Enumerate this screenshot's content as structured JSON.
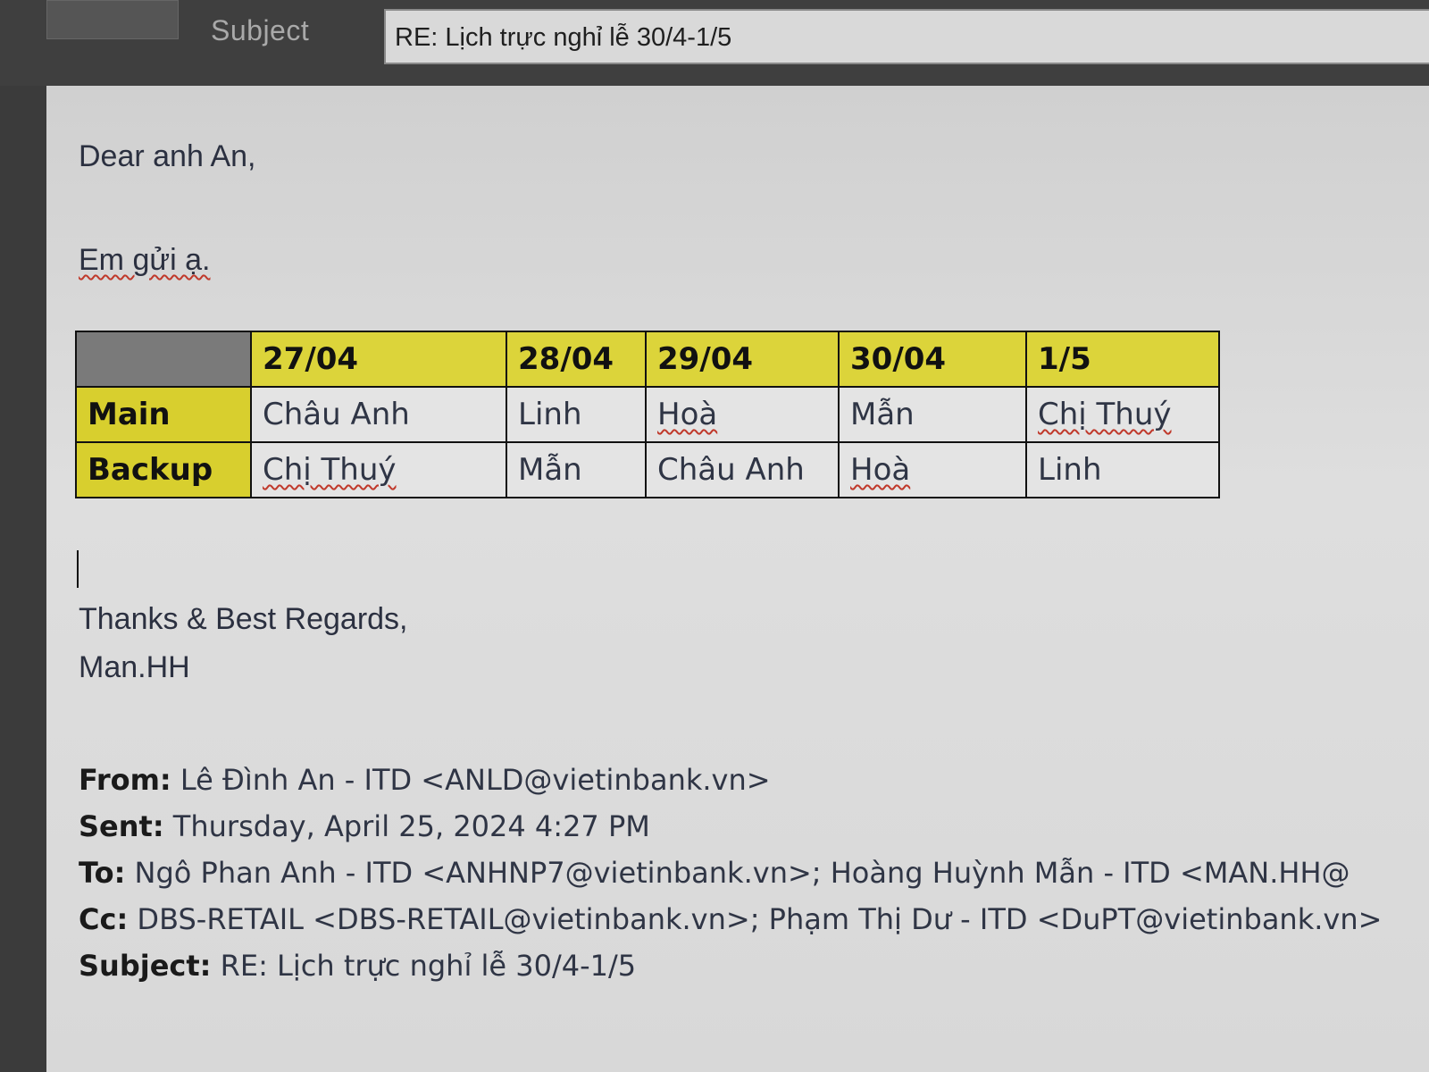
{
  "header": {
    "subject_label": "Subject",
    "subject_value": "RE: Lịch trực nghỉ lễ 30/4-1/5"
  },
  "body": {
    "greeting": "Dear anh An,",
    "intro": "Em gửi ạ.",
    "closing": "Thanks & Best Regards,",
    "signature": "Man.HH"
  },
  "schedule": {
    "columns": [
      "27/04",
      "28/04",
      "29/04",
      "30/04",
      "1/5"
    ],
    "rows": [
      {
        "label": "Main",
        "cells": [
          "Châu Anh",
          "Linh",
          "Hoà",
          "Mẫn",
          "Chị Thuý"
        ]
      },
      {
        "label": "Backup",
        "cells": [
          "Chị Thuý",
          "Mẫn",
          "Châu Anh",
          "Hoà",
          "Linh"
        ]
      }
    ],
    "colors": {
      "header_fill": "#dcd43a",
      "corner_fill": "#7a7a7a",
      "cell_fill": "#e4e4e4"
    }
  },
  "quoted": {
    "from_label": "From:",
    "from_value": "Lê Đình An - ITD <ANLD@vietinbank.vn>",
    "sent_label": "Sent:",
    "sent_value": "Thursday, April 25, 2024 4:27 PM",
    "to_label": "To:",
    "to_value": "Ngô Phan Anh - ITD <ANHNP7@vietinbank.vn>; Hoàng Huỳnh Mẫn - ITD <MAN.HH@",
    "cc_label": "Cc:",
    "cc_value": "DBS-RETAIL <DBS-RETAIL@vietinbank.vn>; Phạm Thị Dư - ITD <DuPT@vietinbank.vn>",
    "subject_label": "Subject:",
    "subject_value": "RE: Lịch trực nghỉ lễ 30/4-1/5"
  }
}
